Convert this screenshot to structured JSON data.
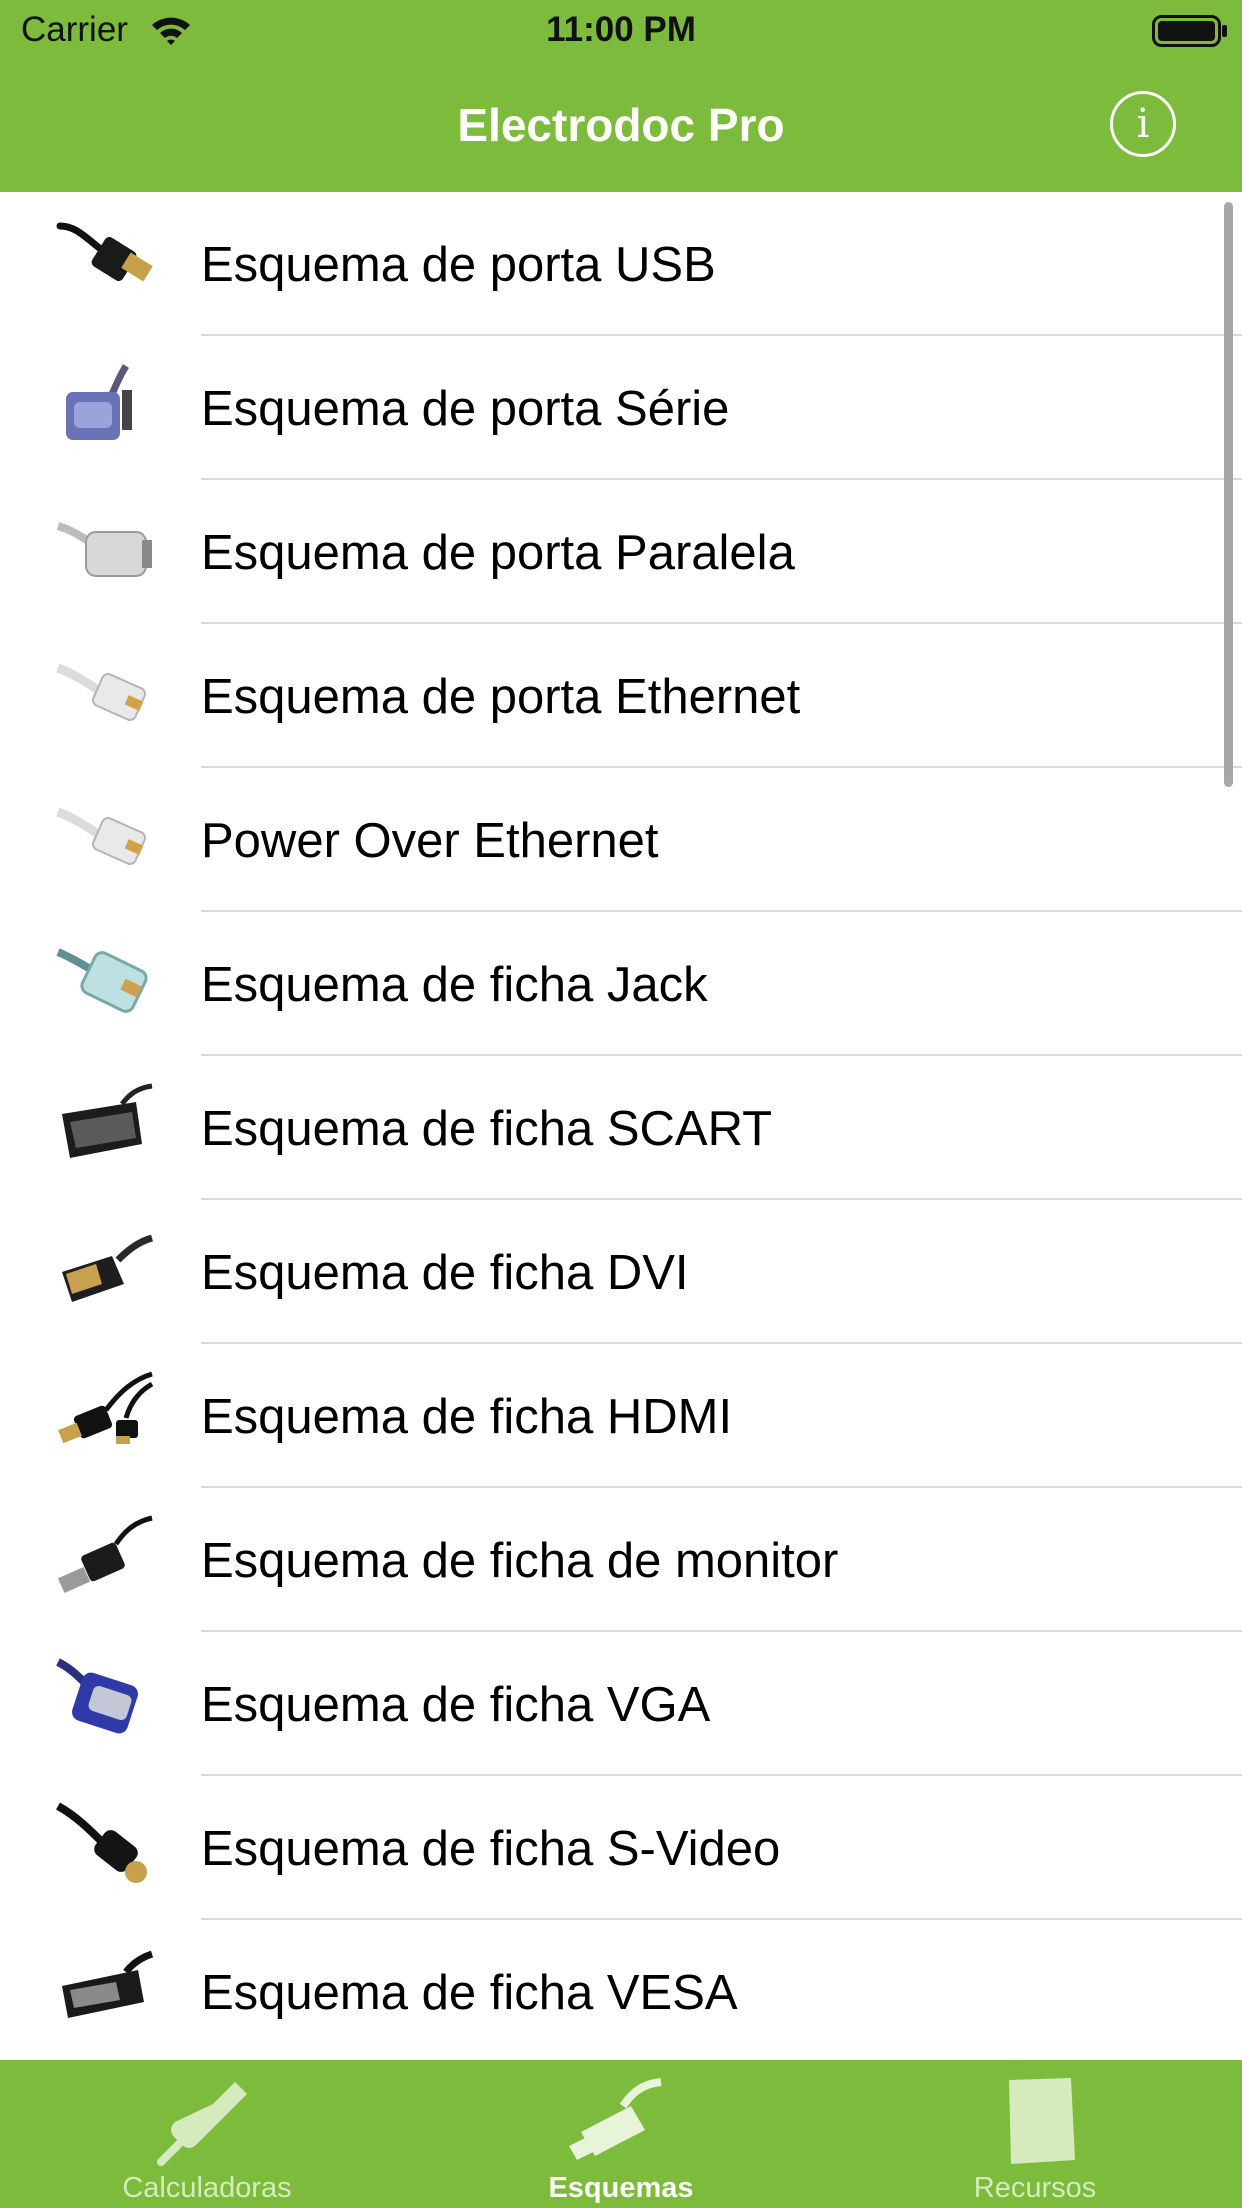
{
  "status": {
    "carrier": "Carrier",
    "time": "11:00 PM"
  },
  "nav": {
    "title": "Electrodoc Pro",
    "info_glyph": "i"
  },
  "list": {
    "items": [
      {
        "label": "Esquema de porta USB",
        "icon": "usb-plug-icon"
      },
      {
        "label": "Esquema de porta Série",
        "icon": "serial-db9-icon"
      },
      {
        "label": "Esquema de porta Paralela",
        "icon": "parallel-db25-icon"
      },
      {
        "label": "Esquema de porta Ethernet",
        "icon": "ethernet-rj45-icon"
      },
      {
        "label": "Power Over Ethernet",
        "icon": "poe-rj45-icon"
      },
      {
        "label": "Esquema de ficha Jack",
        "icon": "rj11-jack-icon"
      },
      {
        "label": "Esquema de ficha SCART",
        "icon": "scart-plug-icon"
      },
      {
        "label": "Esquema de ficha DVI",
        "icon": "dvi-plug-icon"
      },
      {
        "label": "Esquema de ficha HDMI",
        "icon": "hdmi-plug-icon"
      },
      {
        "label": "Esquema de ficha de monitor",
        "icon": "displayport-plug-icon"
      },
      {
        "label": "Esquema de ficha VGA",
        "icon": "vga-plug-icon"
      },
      {
        "label": "Esquema de ficha S-Video",
        "icon": "svideo-plug-icon"
      },
      {
        "label": "Esquema de ficha VESA",
        "icon": "vesa-plug-icon"
      }
    ]
  },
  "tabs": [
    {
      "label": "Calculadoras",
      "icon": "calculator-probe-icon",
      "active": false
    },
    {
      "label": "Esquemas",
      "icon": "cable-plug-icon",
      "active": true
    },
    {
      "label": "Recursos",
      "icon": "document-icon",
      "active": false
    }
  ],
  "colors": {
    "accent": "#7cbb3c",
    "tab_inactive": "#d6ebbd",
    "separator": "#d9d9dc"
  }
}
